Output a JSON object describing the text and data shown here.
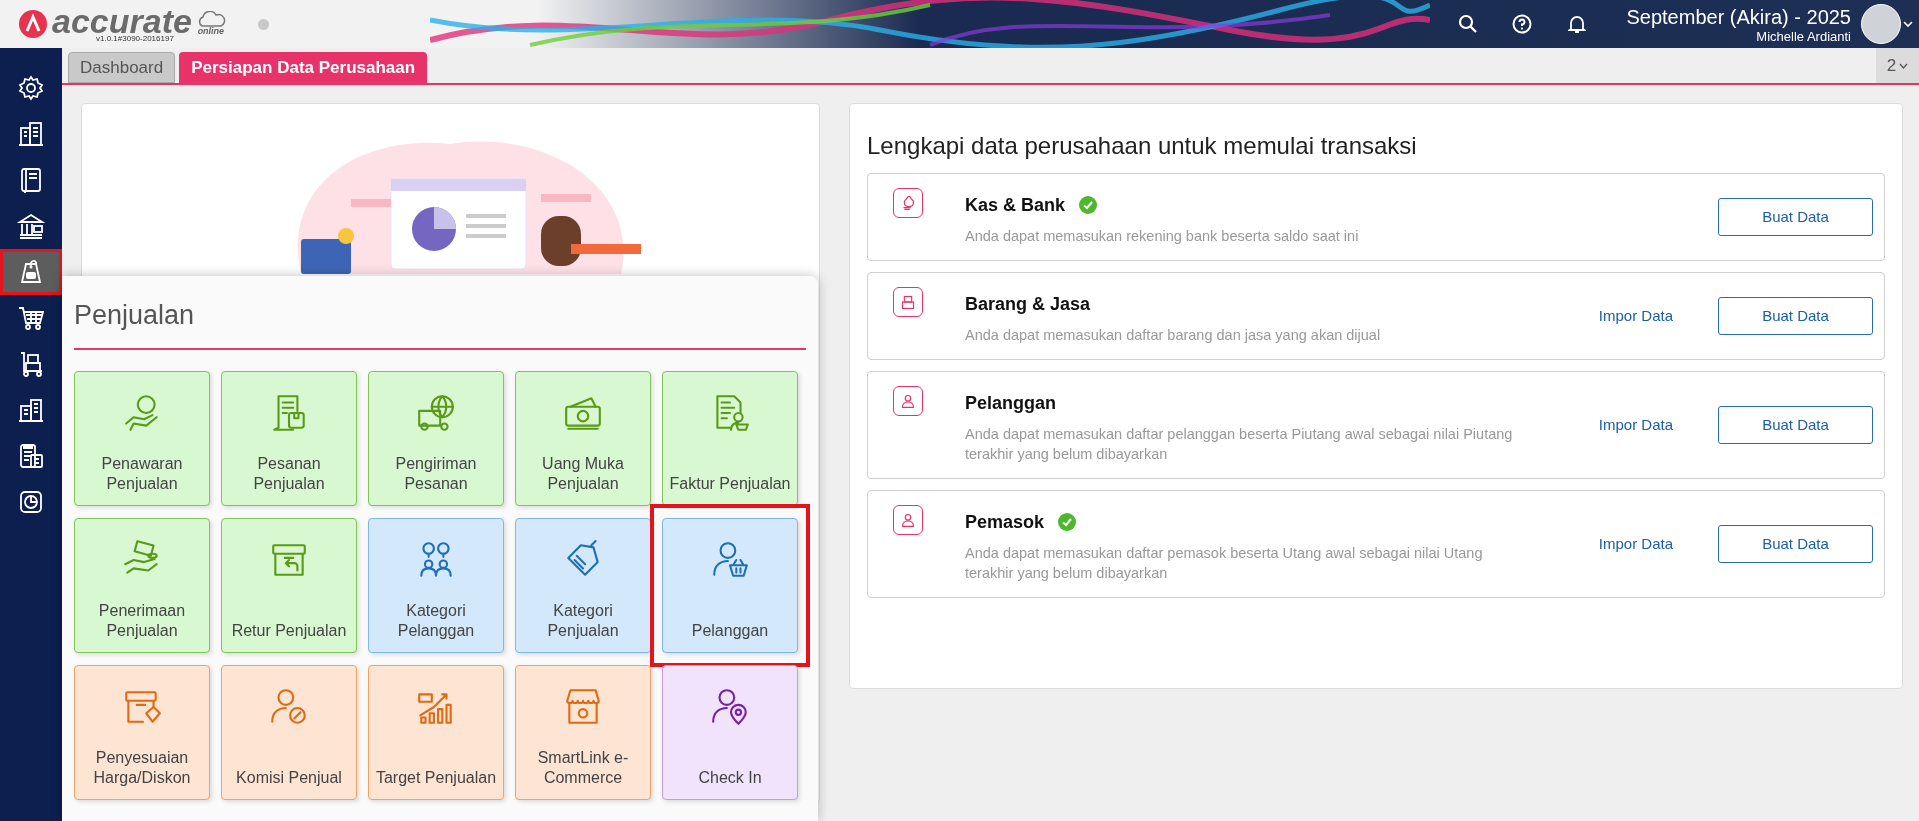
{
  "header": {
    "logo_text": "accurate",
    "logo_sub": "online",
    "version": "v1.0.1#3090-2016197",
    "period": "September (Akira) - 2025",
    "user": "Michelle Ardianti"
  },
  "sidebar": {
    "items": [
      {
        "selected": false,
        "highlighted": false
      },
      {
        "selected": false,
        "highlighted": false
      },
      {
        "selected": false,
        "highlighted": false
      },
      {
        "selected": false,
        "highlighted": false
      },
      {
        "selected": true,
        "highlighted": true
      },
      {
        "selected": false,
        "highlighted": false
      },
      {
        "selected": false,
        "highlighted": false
      },
      {
        "selected": false,
        "highlighted": false
      },
      {
        "selected": false,
        "highlighted": false
      },
      {
        "selected": false,
        "highlighted": false
      }
    ]
  },
  "tabs": [
    {
      "label": "Dashboard",
      "selected": false
    },
    {
      "label": "Persiapan Data Perusahaan",
      "selected": true
    }
  ],
  "tab_overflow": "2",
  "menu": {
    "title": "Penjualan",
    "tiles": [
      {
        "label": "Penawaran Penjualan",
        "color": "#5a9a16",
        "highlighted": false
      },
      {
        "label": "Pesanan Penjualan",
        "color": "#5a9a16",
        "highlighted": false
      },
      {
        "label": "Pengiriman Pesanan",
        "color": "#5a9a16",
        "highlighted": false
      },
      {
        "label": "Uang Muka Penjualan",
        "color": "#5a9a16",
        "highlighted": false
      },
      {
        "label": "Faktur Penjualan",
        "color": "#5a9a16",
        "highlighted": false
      },
      {
        "label": "Penerimaan Penjualan",
        "color": "#5a9a16",
        "highlighted": false
      },
      {
        "label": "Retur Penjualan",
        "color": "#5a9a16",
        "highlighted": false
      },
      {
        "label": "Kategori Pelanggan",
        "color": "#1f6fb2",
        "highlighted": false
      },
      {
        "label": "Kategori Penjualan",
        "color": "#1f6fb2",
        "highlighted": false
      },
      {
        "label": "Pelanggan",
        "color": "#1f6fb2",
        "highlighted": true
      },
      {
        "label": "Penyesuaian Harga/Diskon",
        "color": "#e06a12",
        "highlighted": false
      },
      {
        "label": "Komisi Penjual",
        "color": "#e06a12",
        "highlighted": false
      },
      {
        "label": "Target Penjualan",
        "color": "#e06a12",
        "highlighted": false
      },
      {
        "label": "SmartLink e-Commerce",
        "color": "#e06a12",
        "highlighted": false
      },
      {
        "label": "Check In",
        "color": "#7a1fa8",
        "highlighted": false
      }
    ]
  },
  "setup": {
    "title": "Lengkapi data perusahaan untuk memulai transaksi",
    "items": [
      {
        "title": "Kas & Bank",
        "completed": true,
        "description": "Anda dapat memasukan rekening bank beserta saldo saat ini",
        "button": "Buat Data"
      },
      {
        "title": "Barang & Jasa",
        "completed": false,
        "description": "Anda dapat memasukan daftar barang dan jasa yang akan dijual",
        "import_link": "Impor Data",
        "button": "Buat Data"
      },
      {
        "title": "Pelanggan",
        "completed": false,
        "description": "Anda dapat memasukan daftar pelanggan beserta Piutang awal sebagai nilai Piutang terakhir yang belum dibayarkan",
        "import_link": "Impor Data",
        "button": "Buat Data"
      },
      {
        "title": "Pemasok",
        "completed": true,
        "description": "Anda dapat memasukan daftar pemasok beserta Utang awal sebagai nilai Utang terakhir yang belum dibayarkan",
        "import_link": "Impor Data",
        "button": "Buat Data"
      }
    ]
  }
}
